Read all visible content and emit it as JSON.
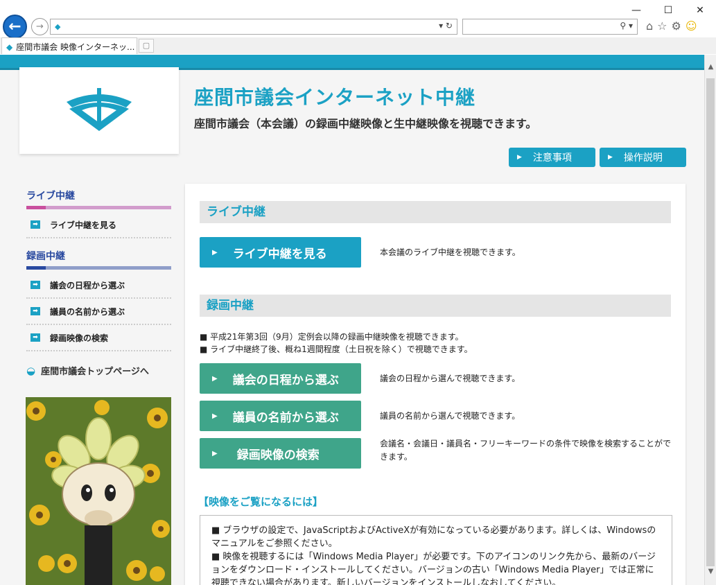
{
  "browser": {
    "tab_title": "座間市議会 映像インターネッ...",
    "window_controls": {
      "minimize": "—",
      "maximize": "☐",
      "close": "✕"
    }
  },
  "header": {
    "title": "座間市議会インターネット中継",
    "subtitle": "座間市議会（本会議）の録画中継映像と生中継映像を視聴できます。",
    "buttons": [
      {
        "label": "注意事項"
      },
      {
        "label": "操作説明"
      }
    ]
  },
  "sidebar": {
    "live_heading": "ライブ中継",
    "live_items": [
      {
        "label": "ライブ中継を見る"
      }
    ],
    "recorded_heading": "録画中継",
    "recorded_items": [
      {
        "label": "議会の日程から選ぶ"
      },
      {
        "label": "議員の名前から選ぶ"
      },
      {
        "label": "録画映像の検索"
      }
    ],
    "top_link": "座間市議会トップページへ"
  },
  "main": {
    "live_section": "ライブ中継",
    "live_button": "ライブ中継を見る",
    "live_desc": "本会議のライブ中継を視聴できます。",
    "recorded_section": "録画中継",
    "notes": [
      "■ 平成21年第3回（9月）定例会以降の録画中継映像を視聴できます。",
      "■ ライブ中継終了後、概ね1週間程度（土日祝を除く）で視聴できます。"
    ],
    "recorded_buttons": [
      {
        "label": "議会の日程から選ぶ",
        "desc": "議会の日程から選んで視聴できます。"
      },
      {
        "label": "議員の名前から選ぶ",
        "desc": "議員の名前から選んで視聴できます。"
      },
      {
        "label": "録画映像の検索",
        "desc": "会議名・会議日・議員名・フリーキーワードの条件で映像を検索することができます。"
      }
    ],
    "viewing_title": "【映像をご覧になるには】",
    "viewing_lines": [
      "■ ブラウザの設定で、JavaScriptおよびActiveXが有効になっている必要があります。詳しくは、Windowsのマニュアルをご参照ください。",
      "■ 映像を視聴するには「Windows Media Player」が必要です。下のアイコンのリンク先から、最新のバージョンをダウンロード・インストールしてください。バージョンの古い「Windows Media Player」では正常に視聴できない場合があります。新しいバージョンをインストールしなおしてください。"
    ]
  },
  "colors": {
    "accent": "#1ba1c4",
    "green": "#3fa58a",
    "live_bar": "#c9509e",
    "rec_bar": "#2a4aa0"
  }
}
